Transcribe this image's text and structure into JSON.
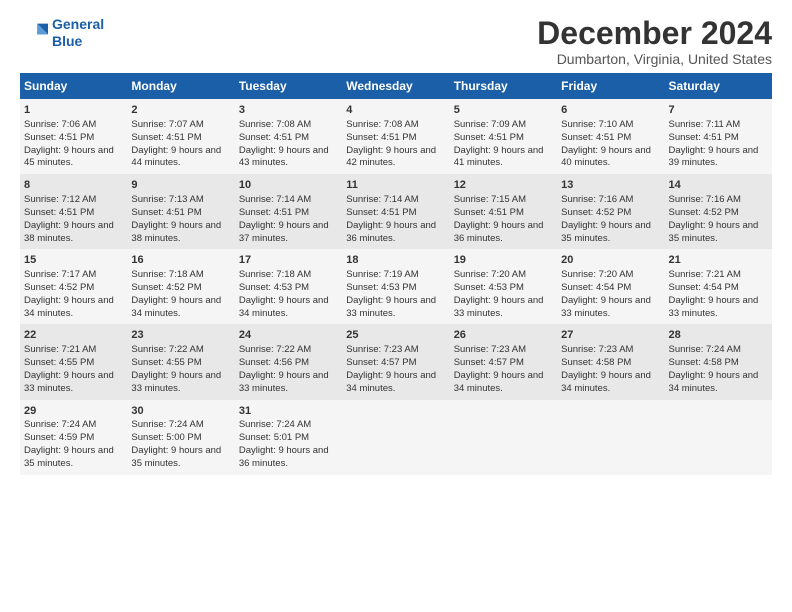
{
  "logo": {
    "line1": "General",
    "line2": "Blue"
  },
  "title": "December 2024",
  "subtitle": "Dumbarton, Virginia, United States",
  "days_header": [
    "Sunday",
    "Monday",
    "Tuesday",
    "Wednesday",
    "Thursday",
    "Friday",
    "Saturday"
  ],
  "weeks": [
    [
      {
        "day": "1",
        "sunrise": "7:06 AM",
        "sunset": "4:51 PM",
        "daylight": "9 hours and 45 minutes."
      },
      {
        "day": "2",
        "sunrise": "7:07 AM",
        "sunset": "4:51 PM",
        "daylight": "9 hours and 44 minutes."
      },
      {
        "day": "3",
        "sunrise": "7:08 AM",
        "sunset": "4:51 PM",
        "daylight": "9 hours and 43 minutes."
      },
      {
        "day": "4",
        "sunrise": "7:08 AM",
        "sunset": "4:51 PM",
        "daylight": "9 hours and 42 minutes."
      },
      {
        "day": "5",
        "sunrise": "7:09 AM",
        "sunset": "4:51 PM",
        "daylight": "9 hours and 41 minutes."
      },
      {
        "day": "6",
        "sunrise": "7:10 AM",
        "sunset": "4:51 PM",
        "daylight": "9 hours and 40 minutes."
      },
      {
        "day": "7",
        "sunrise": "7:11 AM",
        "sunset": "4:51 PM",
        "daylight": "9 hours and 39 minutes."
      }
    ],
    [
      {
        "day": "8",
        "sunrise": "7:12 AM",
        "sunset": "4:51 PM",
        "daylight": "9 hours and 38 minutes."
      },
      {
        "day": "9",
        "sunrise": "7:13 AM",
        "sunset": "4:51 PM",
        "daylight": "9 hours and 38 minutes."
      },
      {
        "day": "10",
        "sunrise": "7:14 AM",
        "sunset": "4:51 PM",
        "daylight": "9 hours and 37 minutes."
      },
      {
        "day": "11",
        "sunrise": "7:14 AM",
        "sunset": "4:51 PM",
        "daylight": "9 hours and 36 minutes."
      },
      {
        "day": "12",
        "sunrise": "7:15 AM",
        "sunset": "4:51 PM",
        "daylight": "9 hours and 36 minutes."
      },
      {
        "day": "13",
        "sunrise": "7:16 AM",
        "sunset": "4:52 PM",
        "daylight": "9 hours and 35 minutes."
      },
      {
        "day": "14",
        "sunrise": "7:16 AM",
        "sunset": "4:52 PM",
        "daylight": "9 hours and 35 minutes."
      }
    ],
    [
      {
        "day": "15",
        "sunrise": "7:17 AM",
        "sunset": "4:52 PM",
        "daylight": "9 hours and 34 minutes."
      },
      {
        "day": "16",
        "sunrise": "7:18 AM",
        "sunset": "4:52 PM",
        "daylight": "9 hours and 34 minutes."
      },
      {
        "day": "17",
        "sunrise": "7:18 AM",
        "sunset": "4:53 PM",
        "daylight": "9 hours and 34 minutes."
      },
      {
        "day": "18",
        "sunrise": "7:19 AM",
        "sunset": "4:53 PM",
        "daylight": "9 hours and 33 minutes."
      },
      {
        "day": "19",
        "sunrise": "7:20 AM",
        "sunset": "4:53 PM",
        "daylight": "9 hours and 33 minutes."
      },
      {
        "day": "20",
        "sunrise": "7:20 AM",
        "sunset": "4:54 PM",
        "daylight": "9 hours and 33 minutes."
      },
      {
        "day": "21",
        "sunrise": "7:21 AM",
        "sunset": "4:54 PM",
        "daylight": "9 hours and 33 minutes."
      }
    ],
    [
      {
        "day": "22",
        "sunrise": "7:21 AM",
        "sunset": "4:55 PM",
        "daylight": "9 hours and 33 minutes."
      },
      {
        "day": "23",
        "sunrise": "7:22 AM",
        "sunset": "4:55 PM",
        "daylight": "9 hours and 33 minutes."
      },
      {
        "day": "24",
        "sunrise": "7:22 AM",
        "sunset": "4:56 PM",
        "daylight": "9 hours and 33 minutes."
      },
      {
        "day": "25",
        "sunrise": "7:23 AM",
        "sunset": "4:57 PM",
        "daylight": "9 hours and 34 minutes."
      },
      {
        "day": "26",
        "sunrise": "7:23 AM",
        "sunset": "4:57 PM",
        "daylight": "9 hours and 34 minutes."
      },
      {
        "day": "27",
        "sunrise": "7:23 AM",
        "sunset": "4:58 PM",
        "daylight": "9 hours and 34 minutes."
      },
      {
        "day": "28",
        "sunrise": "7:24 AM",
        "sunset": "4:58 PM",
        "daylight": "9 hours and 34 minutes."
      }
    ],
    [
      {
        "day": "29",
        "sunrise": "7:24 AM",
        "sunset": "4:59 PM",
        "daylight": "9 hours and 35 minutes."
      },
      {
        "day": "30",
        "sunrise": "7:24 AM",
        "sunset": "5:00 PM",
        "daylight": "9 hours and 35 minutes."
      },
      {
        "day": "31",
        "sunrise": "7:24 AM",
        "sunset": "5:01 PM",
        "daylight": "9 hours and 36 minutes."
      },
      null,
      null,
      null,
      null
    ]
  ]
}
